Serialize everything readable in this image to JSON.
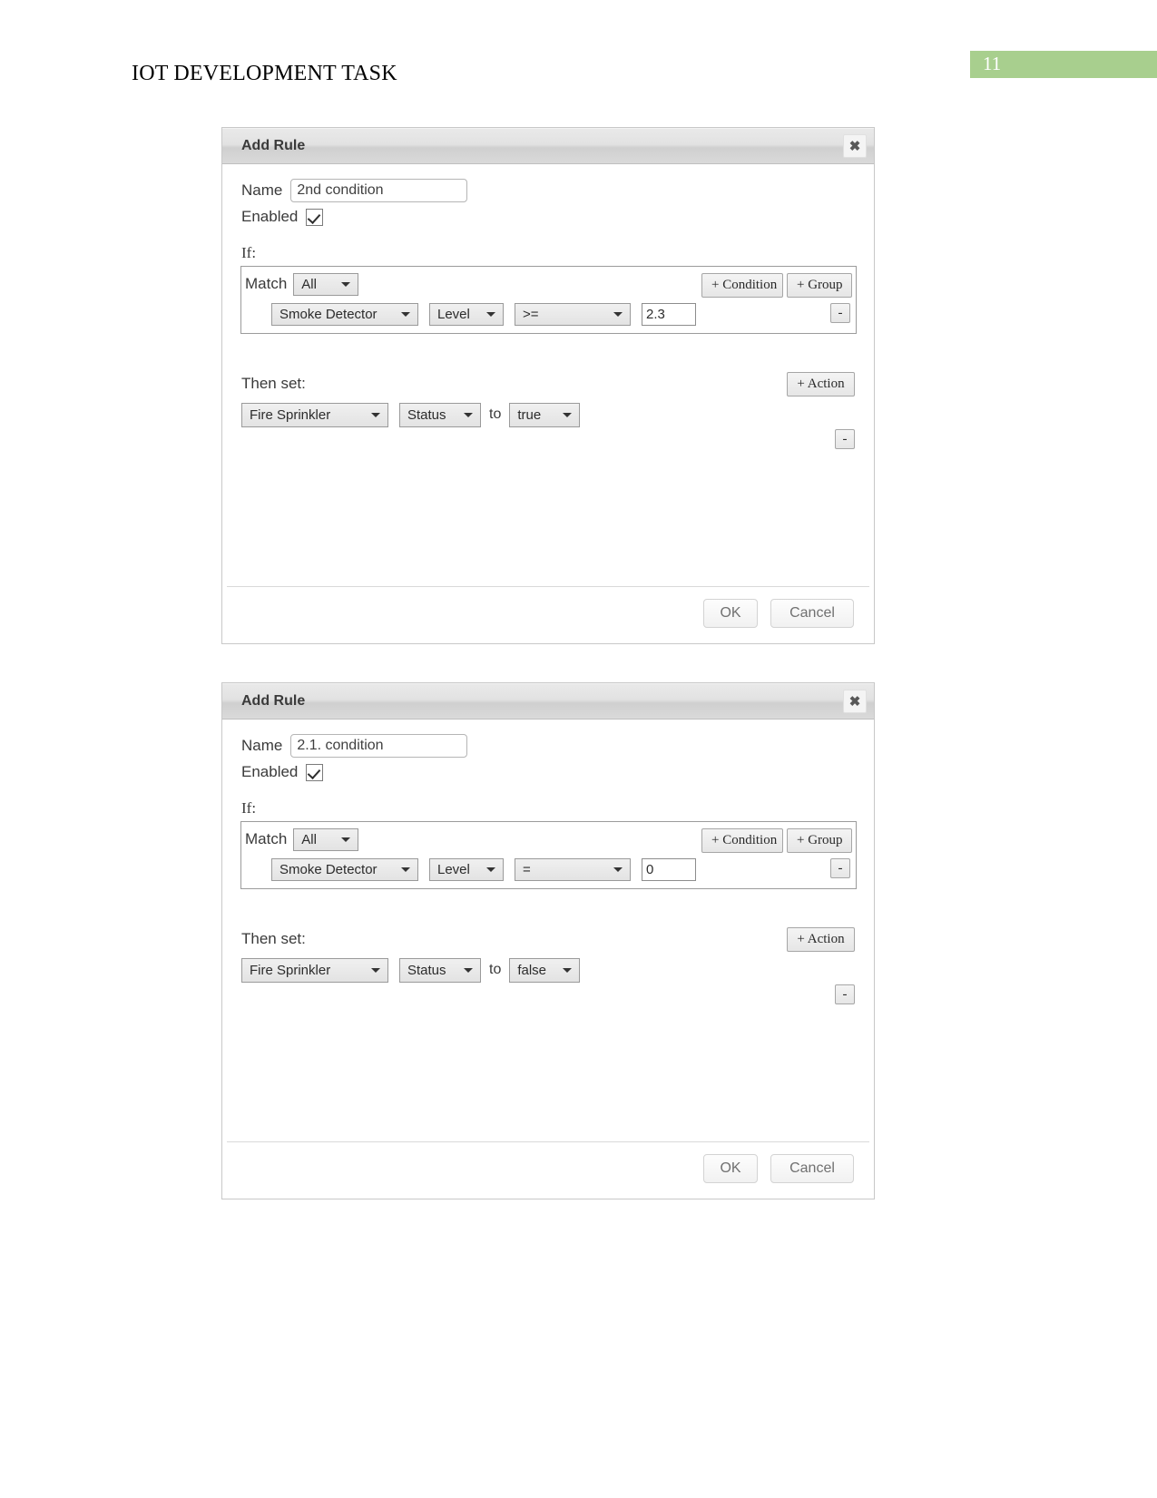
{
  "document": {
    "header_title": "IOT DEVELOPMENT TASK",
    "page_number": "11"
  },
  "theme": {
    "page_band_color": "#a8cf8e",
    "titlebar_text_color": "#3a3a3a"
  },
  "dialogs": [
    {
      "title": "Add Rule",
      "close_icon": "close-icon",
      "name_label": "Name",
      "name_value": "2nd condition",
      "name_placeholder": "",
      "enabled_label": "Enabled",
      "enabled_checked": "true",
      "if_label": "If:",
      "match_label": "Match",
      "match_value": "All",
      "add_condition_label": "+ Condition",
      "add_group_label": "+ Group",
      "remove_condition_label": "-",
      "condition": {
        "device": "Smoke Detector",
        "property": "Level",
        "operator": ">=",
        "value": "2.3"
      },
      "then_set_label": "Then set:",
      "add_action_label": "+ Action",
      "remove_action_label": "-",
      "action": {
        "device": "Fire Sprinkler",
        "property": "Status",
        "to_word": "to",
        "value": "true"
      },
      "ok_label": "OK",
      "cancel_label": "Cancel"
    },
    {
      "title": "Add Rule",
      "close_icon": "close-icon",
      "name_label": "Name",
      "name_value": "2.1. condition",
      "name_placeholder": "",
      "enabled_label": "Enabled",
      "enabled_checked": "true",
      "if_label": "If:",
      "match_label": "Match",
      "match_value": "All",
      "add_condition_label": "+ Condition",
      "add_group_label": "+ Group",
      "remove_condition_label": "-",
      "condition": {
        "device": "Smoke Detector",
        "property": "Level",
        "operator": "=",
        "value": "0"
      },
      "then_set_label": "Then set:",
      "add_action_label": "+ Action",
      "remove_action_label": "-",
      "action": {
        "device": "Fire Sprinkler",
        "property": "Status",
        "to_word": "to",
        "value": "false"
      },
      "ok_label": "OK",
      "cancel_label": "Cancel"
    }
  ]
}
